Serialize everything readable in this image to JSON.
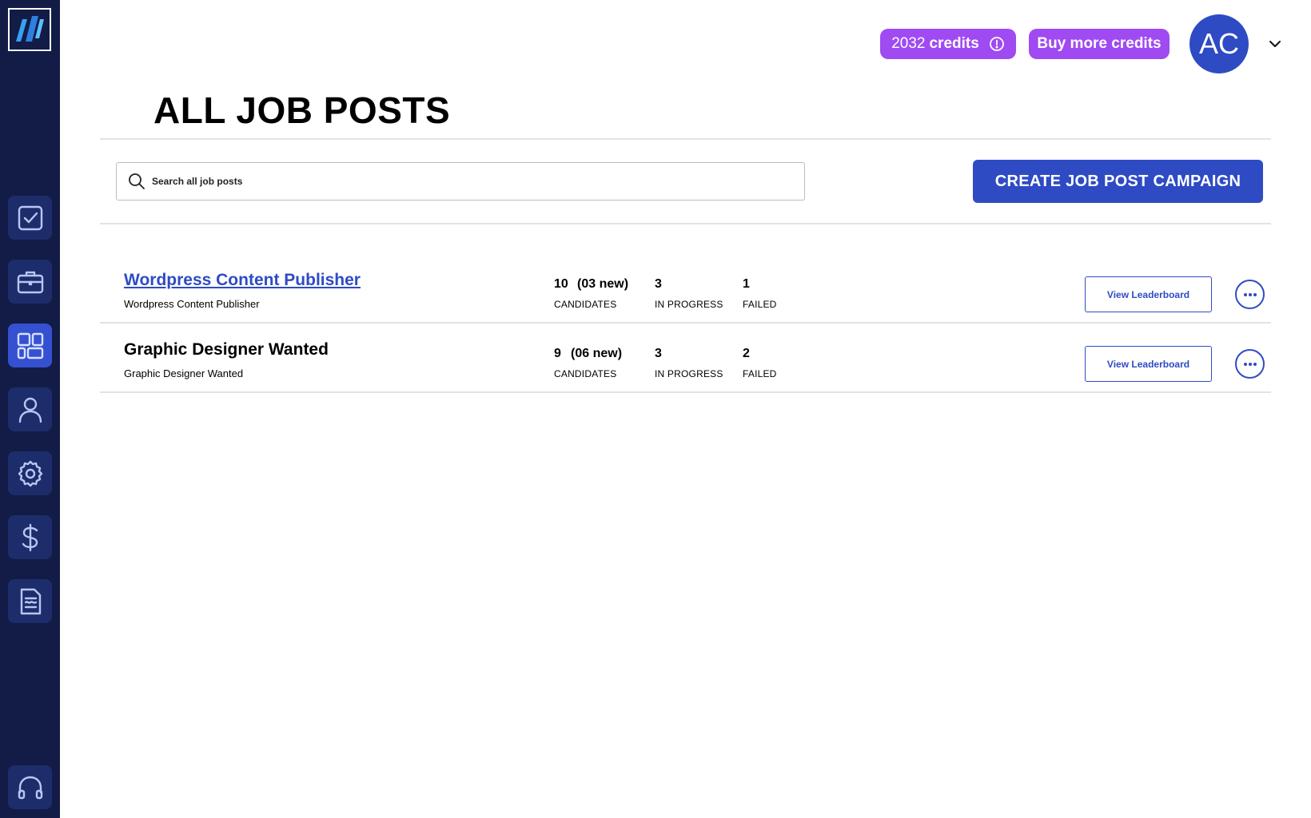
{
  "header": {
    "credits_value": "2032",
    "credits_label": "credits",
    "buy_credits_label": "Buy more credits",
    "avatar_initials": "AC"
  },
  "page": {
    "title": "ALL JOB POSTS",
    "search_placeholder": "Search all job posts",
    "create_button_label": "CREATE JOB POST CAMPAIGN"
  },
  "sidebar": {
    "items": [
      {
        "icon": "checkbox-icon"
      },
      {
        "icon": "briefcase-icon"
      },
      {
        "icon": "dashboard-icon",
        "active": true
      },
      {
        "icon": "user-icon"
      },
      {
        "icon": "gear-icon"
      },
      {
        "icon": "dollar-icon"
      },
      {
        "icon": "document-icon"
      },
      {
        "icon": "headset-icon"
      }
    ]
  },
  "jobs": [
    {
      "title": "Wordpress Content Publisher",
      "subtitle": "Wordpress Content Publisher",
      "candidates": "10",
      "new": "(03 new)",
      "candidates_label": "CANDIDATES",
      "in_progress": "3",
      "in_progress_label": "IN PROGRESS",
      "failed": "1",
      "failed_label": "FAILED",
      "view_label": "View Leaderboard"
    },
    {
      "title": "Graphic Designer Wanted",
      "subtitle": "Graphic Designer Wanted",
      "candidates": "9",
      "new": "(06 new)",
      "candidates_label": "CANDIDATES",
      "in_progress": "3",
      "in_progress_label": "IN PROGRESS",
      "failed": "2",
      "failed_label": "FAILED",
      "view_label": "View Leaderboard"
    }
  ],
  "colors": {
    "sidebar_bg": "#121c47",
    "primary": "#2e4bc4",
    "credits_purple": "#a04af2"
  }
}
